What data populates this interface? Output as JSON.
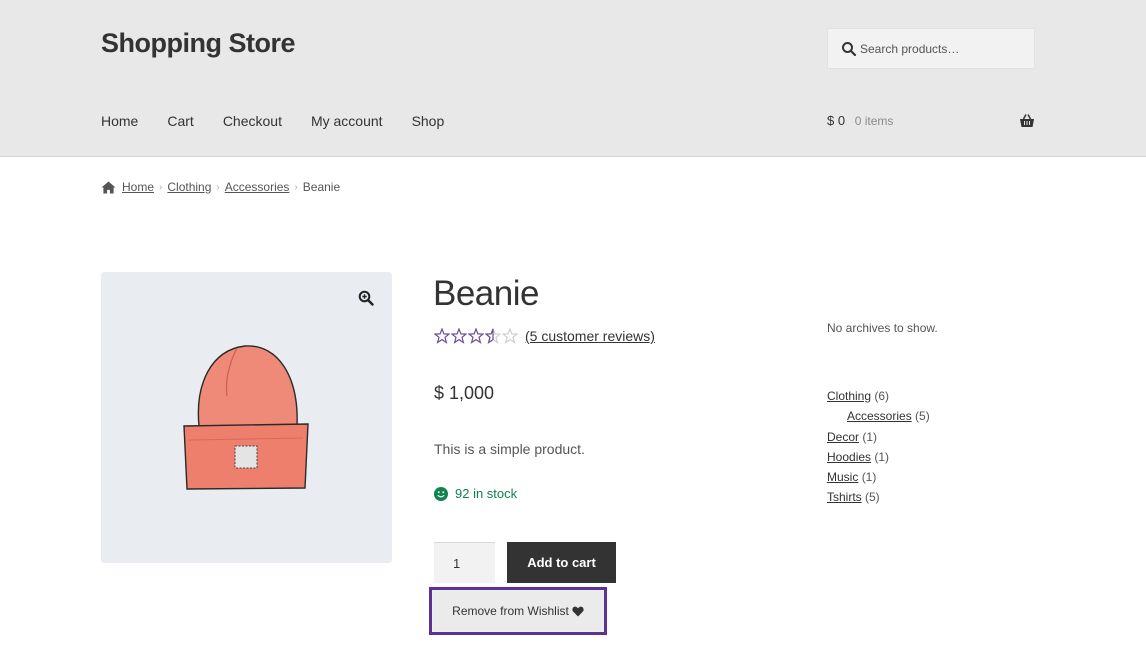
{
  "header": {
    "site_title": "Shopping Store",
    "search": {
      "placeholder": "Search products…"
    },
    "nav": [
      "Home",
      "Cart",
      "Checkout",
      "My account",
      "Shop"
    ],
    "cart": {
      "amount": "$ 0",
      "items": "0 items"
    }
  },
  "breadcrumb": {
    "items": [
      "Home",
      "Clothing",
      "Accessories"
    ],
    "current": "Beanie"
  },
  "product": {
    "title": "Beanie",
    "rating": 3.5,
    "rating_max": 5,
    "reviews_label": "(5 customer reviews)",
    "price": "$ 1,000",
    "description": "This is a simple product.",
    "stock": "92 in stock",
    "quantity": "1",
    "add_to_cart_label": "Add to cart",
    "wishlist_label": "Remove from Wishlist"
  },
  "sidebar": {
    "archives_empty": "No archives to show.",
    "categories": [
      {
        "name": "Clothing",
        "count": "(6)"
      },
      {
        "name": "Accessories",
        "count": "(5)"
      },
      {
        "name": "Decor",
        "count": "(1)"
      },
      {
        "name": "Hoodies",
        "count": "(1)"
      },
      {
        "name": "Music",
        "count": "(1)"
      },
      {
        "name": "Tshirts",
        "count": "(5)"
      }
    ]
  },
  "colors": {
    "header_bg": "#e8e8e8",
    "star": "#6b4e9b",
    "stock": "#0f834d",
    "focus_outline": "#5e3193",
    "button_dark": "#333333"
  }
}
